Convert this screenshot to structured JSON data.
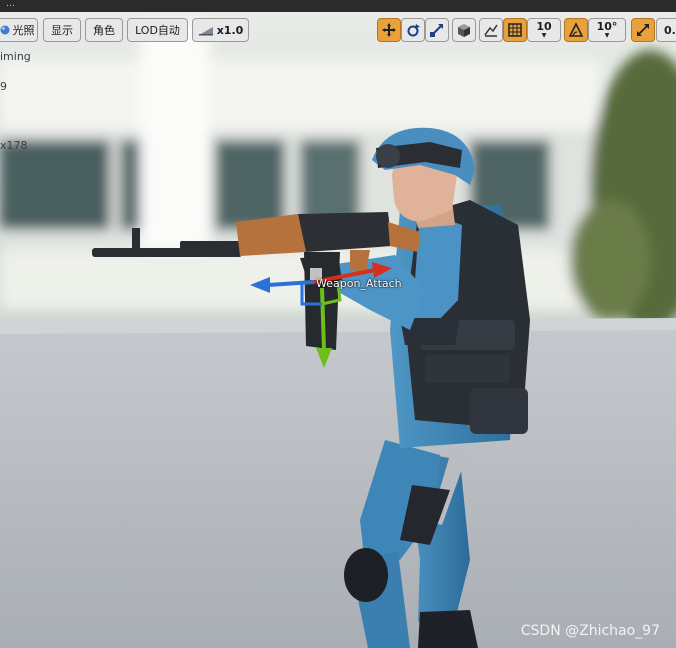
{
  "window": {
    "title_fragment": "…"
  },
  "toolbar_left": {
    "lighting_label": "光照",
    "show_label": "显示",
    "character_label": "角色",
    "lod_label": "LOD自动",
    "speed_label": "x1.0"
  },
  "toolbar_right": {
    "grid_snap_value": "10",
    "rotation_snap_value": "10°",
    "scale_snap_value": "0."
  },
  "stats": [
    "iming",
    "9",
    "x178"
  ],
  "scene": {
    "socket_label": "Weapon_Attach"
  },
  "watermark": "CSDN @Zhichao_97",
  "colors": {
    "toolbar_active": "#e9a13b",
    "axis_x": "#d6301d",
    "axis_y": "#6fbf1a",
    "axis_z": "#2a71d8",
    "ground": "#b6bbc0"
  }
}
